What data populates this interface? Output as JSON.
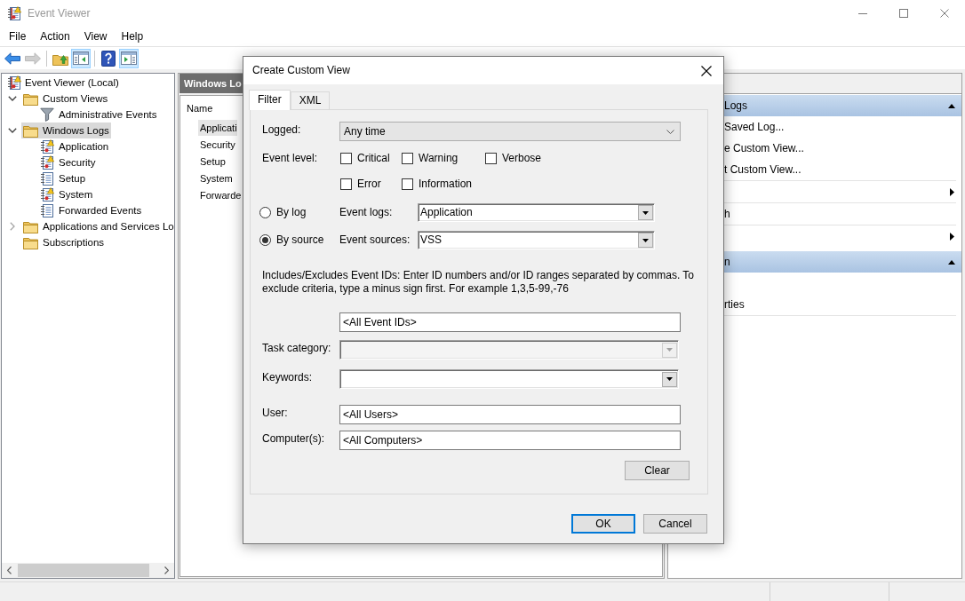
{
  "window": {
    "title": "Event Viewer"
  },
  "menu": [
    {
      "label": "File"
    },
    {
      "label": "Action"
    },
    {
      "label": "View"
    },
    {
      "label": "Help"
    }
  ],
  "toolbar": [
    {
      "kind": "back",
      "disabled": false,
      "pressed": false
    },
    {
      "kind": "forward",
      "disabled": true,
      "pressed": false
    },
    {
      "kind": "separator"
    },
    {
      "kind": "up",
      "disabled": false,
      "pressed": false
    },
    {
      "kind": "tree",
      "disabled": false,
      "pressed": true
    },
    {
      "kind": "separator"
    },
    {
      "kind": "help",
      "disabled": false,
      "pressed": false
    },
    {
      "kind": "actions",
      "disabled": false,
      "pressed": true
    }
  ],
  "tree": [
    {
      "label": "Event Viewer (Local)",
      "kind": "root",
      "selected": false,
      "children": [
        {
          "label": "Custom Views",
          "kind": "folder",
          "expanded": true,
          "selected": false,
          "children": [
            {
              "label": "Administrative Events",
              "kind": "filter",
              "selected": false
            }
          ]
        },
        {
          "label": "Windows Logs",
          "kind": "folder",
          "expanded": true,
          "selected": true,
          "children": [
            {
              "label": "Application",
              "kind": "warnlog",
              "selected": false
            },
            {
              "label": "Security",
              "kind": "warnlog",
              "selected": false
            },
            {
              "label": "Setup",
              "kind": "log",
              "selected": false
            },
            {
              "label": "System",
              "kind": "warnlog",
              "selected": false
            },
            {
              "label": "Forwarded Events",
              "kind": "log",
              "selected": false
            }
          ]
        },
        {
          "label": "Applications and Services Lo",
          "kind": "folder",
          "expanded": false,
          "selected": false
        },
        {
          "label": "Subscriptions",
          "kind": "folder",
          "selected": false
        }
      ]
    }
  ],
  "center": {
    "title": "Windows Lo",
    "column": "Name",
    "rows": [
      {
        "label": "Applicati",
        "selected": true
      },
      {
        "label": "Security",
        "selected": false
      },
      {
        "label": "Setup",
        "selected": false
      },
      {
        "label": "System",
        "selected": false
      },
      {
        "label": "Forwarde",
        "selected": false
      }
    ]
  },
  "actions": {
    "sections": [
      {
        "title": "Logs",
        "expanded": true,
        "items": [
          {
            "kind": "action",
            "label": "Saved Log..."
          },
          {
            "kind": "action",
            "label": "e Custom View..."
          },
          {
            "kind": "action",
            "label": "t Custom View..."
          },
          {
            "kind": "separator"
          },
          {
            "kind": "submenu"
          },
          {
            "kind": "separator"
          },
          {
            "kind": "action",
            "label": "h"
          },
          {
            "kind": "separator"
          },
          {
            "kind": "submenu"
          }
        ]
      },
      {
        "title": "n",
        "expanded": true,
        "items": [
          {
            "kind": "action",
            "label": "rties"
          },
          {
            "kind": "separator"
          }
        ]
      }
    ]
  },
  "dialog": {
    "title": "Create Custom View",
    "tabs": [
      {
        "label": "Filter",
        "selected": true
      },
      {
        "label": "XML",
        "selected": false
      }
    ],
    "filter": {
      "logged": {
        "label": "Logged:",
        "value": "Any time"
      },
      "event_level": {
        "label": "Event level:",
        "options": [
          {
            "label": "Critical",
            "checked": false
          },
          {
            "label": "Warning",
            "checked": false
          },
          {
            "label": "Verbose",
            "checked": false
          },
          {
            "label": "Error",
            "checked": false
          },
          {
            "label": "Information",
            "checked": false
          }
        ]
      },
      "scope": [
        {
          "label": "By log",
          "selected": false,
          "field_label": "Event logs:",
          "value": "Application"
        },
        {
          "label": "By source",
          "selected": true,
          "field_label": "Event sources:",
          "value": "VSS"
        }
      ],
      "event_ids": {
        "help": "Includes/Excludes Event IDs: Enter ID numbers and/or ID ranges separated by commas. To exclude criteria, type a minus sign first. For example 1,3,5-99,-76",
        "value": "<All Event IDs>"
      },
      "fields": [
        {
          "kind": "combo",
          "label": "Task category:",
          "disabled": true
        },
        {
          "kind": "combo",
          "label": "Keywords:",
          "disabled": false
        },
        {
          "kind": "text",
          "label": "User:",
          "value": "<All Users>"
        },
        {
          "kind": "text",
          "label": "Computer(s):",
          "value": "<All Computers>"
        }
      ],
      "clear_button": "Clear"
    },
    "buttons": [
      {
        "label": "OK",
        "default": true
      },
      {
        "label": "Cancel",
        "default": false
      }
    ]
  }
}
